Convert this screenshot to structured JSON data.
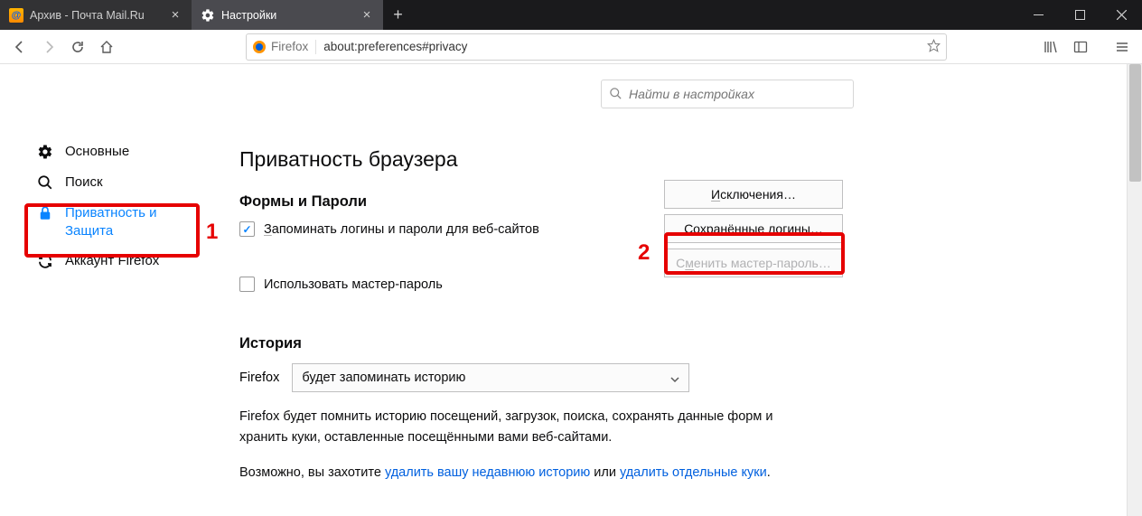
{
  "tabs": [
    {
      "label": "Архив - Почта Mail.Ru",
      "active": false
    },
    {
      "label": "Настройки",
      "active": true
    }
  ],
  "urlbar": {
    "identity": "Firefox",
    "url": "about:preferences#privacy"
  },
  "search": {
    "placeholder": "Найти в настройках"
  },
  "sidebar": {
    "items": [
      {
        "label": "Основные"
      },
      {
        "label": "Поиск"
      },
      {
        "label": "Приватность и Защита"
      },
      {
        "label": "Аккаунт Firefox"
      }
    ]
  },
  "page": {
    "title": "Приватность браузера",
    "forms_heading": "Формы и Пароли",
    "remember_label": "Запоминать логины и пароли для веб-сайтов",
    "master_label": "Использовать мастер-пароль",
    "btn_exceptions": "Исключения…",
    "btn_saved_logins": "Сохранённые логины…",
    "btn_change_master": "Сменить мастер-пароль…",
    "history_heading": "История",
    "history_lead": "Firefox",
    "history_select": "будет запоминать историю",
    "desc_line1": "Firefox будет помнить историю посещений, загрузок, поиска, сохранять данные форм и хранить куки, оставленные посещёнными вами веб-сайтами.",
    "desc_line2a": "Возможно, вы захотите ",
    "desc_link1": "удалить вашу недавнюю историю",
    "desc_line2b": " или ",
    "desc_link2": "удалить отдельные куки",
    "desc_line2c": "."
  },
  "annotations": {
    "a1": "1",
    "a2": "2"
  }
}
